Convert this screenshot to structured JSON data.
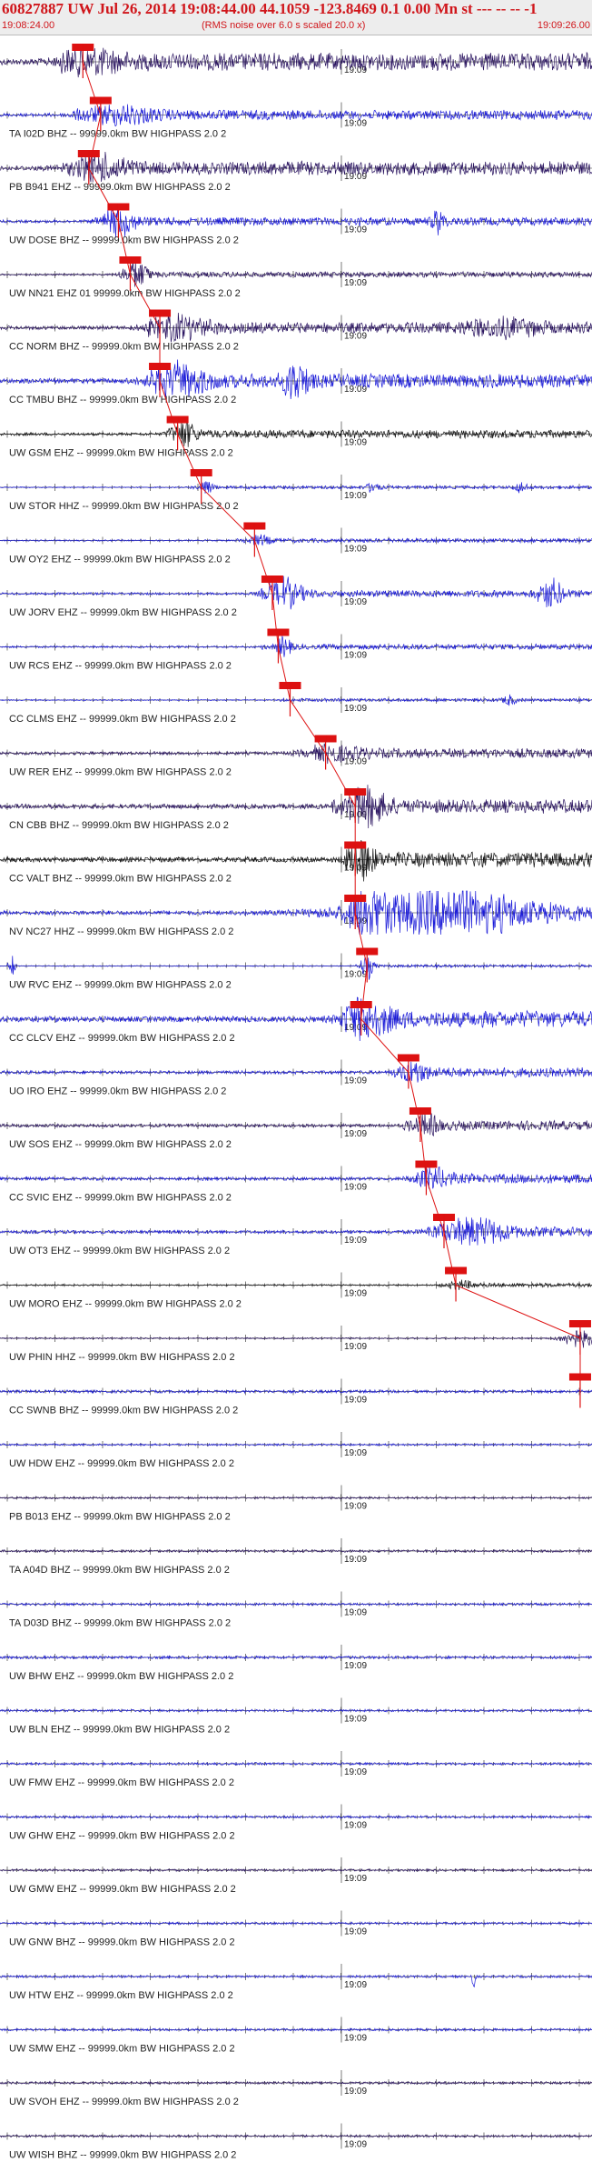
{
  "header": {
    "title": "60827887 UW Jul 26, 2014 19:08:44.00   44.1059 -123.8469  0.1 0.00 Mn st --- -- --  -1",
    "start_time": "19:08:24.00",
    "subtitle": "(RMS noise over 6.0 s scaled 20.0 x)",
    "end_time": "19:09:26.00"
  },
  "chart_data": {
    "type": "line",
    "title": "60827887 UW Jul 26, 2014 19:08:44.00   44.1059 -123.8469  0.1 0.00 Mn st --- -- --  -1",
    "subtitle": "(RMS noise over 6.0 s scaled 20.0 x)",
    "x_range": [
      "19:08:24.00",
      "19:09:26.00"
    ],
    "minute_label": "19:09",
    "colors": {
      "blue": "#1a1ad8",
      "dark": "#2a1460",
      "black": "#111111",
      "pick": "#dd1111",
      "axis": "#222222"
    },
    "traces": [
      {
        "label": "",
        "color": "dark",
        "amp": 0.65,
        "onset": 0.1,
        "pick": 0.14,
        "bursts": [
          [
            0.15,
            0.6,
            0.05
          ]
        ]
      },
      {
        "label": "TA I02D BHZ -- 99999.0km BW  HIGHPASS  2.0  2",
        "color": "blue",
        "amp": 0.35,
        "onset": 0.12,
        "pick": 0.17,
        "bursts": [
          [
            0.2,
            0.5,
            0.06
          ]
        ]
      },
      {
        "label": "PB B941 EHZ -- 99999.0km BW  HIGHPASS  2.0  2",
        "color": "dark",
        "amp": 0.5,
        "onset": 0.14,
        "pick": 0.15,
        "bursts": [
          [
            0.16,
            0.8,
            0.05
          ]
        ]
      },
      {
        "label": "UW DOSE BHZ -- 99999.0km BW  HIGHPASS  2.0  2",
        "color": "blue",
        "amp": 0.3,
        "onset": 0.18,
        "pick": 0.2,
        "bursts": [
          [
            0.2,
            0.9,
            0.03
          ],
          [
            0.74,
            0.8,
            0.01
          ]
        ]
      },
      {
        "label": "UW NN21 EHZ 01 99999.0km BW  HIGHPASS  2.0  2",
        "color": "dark",
        "amp": 0.2,
        "onset": 0.2,
        "pick": 0.22,
        "bursts": [
          [
            0.23,
            1.0,
            0.02
          ]
        ]
      },
      {
        "label": "CC NORM BHZ -- 99999.0km BW  HIGHPASS  2.0  2",
        "color": "dark",
        "amp": 0.4,
        "onset": 0.25,
        "pick": 0.27,
        "bursts": [
          [
            0.3,
            0.7,
            0.05
          ],
          [
            0.85,
            0.5,
            0.06
          ]
        ]
      },
      {
        "label": "CC TMBU BHZ -- 99999.0km BW  HIGHPASS  2.0  2",
        "color": "blue",
        "amp": 0.5,
        "onset": 0.25,
        "pick": 0.27,
        "bursts": [
          [
            0.3,
            1.0,
            0.05
          ],
          [
            0.5,
            1.3,
            0.02
          ]
        ]
      },
      {
        "label": "UW GSM EHZ -- 99999.0km BW  HIGHPASS  2.0  2",
        "color": "black",
        "amp": 0.3,
        "onset": 0.28,
        "pick": 0.3,
        "bursts": [
          [
            0.31,
            0.9,
            0.02
          ]
        ]
      },
      {
        "label": "UW STOR HHZ -- 99999.0km BW  HIGHPASS  2.0  2",
        "color": "blue",
        "amp": 0.12,
        "onset": 0.32,
        "pick": 0.34,
        "bursts": [
          [
            0.35,
            0.6,
            0.01
          ],
          [
            0.63,
            0.4,
            0.01
          ],
          [
            0.88,
            0.4,
            0.01
          ]
        ]
      },
      {
        "label": "UW OY2 EHZ -- 99999.0km BW  HIGHPASS  2.0  2",
        "color": "blue",
        "amp": 0.15,
        "onset": 0.4,
        "pick": 0.43,
        "bursts": [
          [
            0.44,
            0.3,
            0.02
          ]
        ]
      },
      {
        "label": "UW JORV EHZ -- 99999.0km BW  HIGHPASS  2.0  2",
        "color": "blue",
        "amp": 0.25,
        "onset": 0.44,
        "pick": 0.46,
        "bursts": [
          [
            0.48,
            1.0,
            0.03
          ],
          [
            0.93,
            1.0,
            0.02
          ]
        ]
      },
      {
        "label": "UW RCS EHZ -- 99999.0km BW  HIGHPASS  2.0  2",
        "color": "blue",
        "amp": 0.2,
        "onset": 0.44,
        "pick": 0.47,
        "bursts": [
          [
            0.48,
            0.8,
            0.01
          ]
        ]
      },
      {
        "label": "CC CLMS EHZ -- 99999.0km BW  HIGHPASS  2.0  2",
        "color": "blue",
        "amp": 0.12,
        "onset": 0.47,
        "pick": 0.49,
        "bursts": [
          [
            0.86,
            0.4,
            0.01
          ]
        ]
      },
      {
        "label": "UW RER EHZ -- 99999.0km BW  HIGHPASS  2.0  2",
        "color": "dark",
        "amp": 0.35,
        "onset": 0.53,
        "pick": 0.55,
        "bursts": [
          [
            0.56,
            0.4,
            0.05
          ]
        ]
      },
      {
        "label": "CN CBB BHZ -- 99999.0km BW  HIGHPASS  2.0  2",
        "color": "dark",
        "amp": 0.5,
        "onset": 0.56,
        "pick": 0.6,
        "bursts": [
          [
            0.62,
            1.4,
            0.03
          ]
        ]
      },
      {
        "label": "CC VALT BHZ -- 99999.0km BW  HIGHPASS  2.0  2",
        "color": "black",
        "amp": 0.55,
        "onset": 0.58,
        "pick": 0.6,
        "bursts": [
          [
            0.61,
            1.4,
            0.02
          ]
        ]
      },
      {
        "label": "NV NC27 HHZ -- 99999.0km BW  HIGHPASS  2.0  2",
        "color": "blue",
        "amp": 0.45,
        "onset": 0.58,
        "pick": 0.6,
        "bursts": [
          [
            0.62,
            1.5,
            0.02
          ],
          [
            0.75,
            1.5,
            0.15
          ]
        ]
      },
      {
        "label": "UW RVC EHZ -- 99999.0km BW  HIGHPASS  2.0  2",
        "color": "blue",
        "amp": 0.1,
        "onset": 0.6,
        "pick": 0.62,
        "bursts": [
          [
            0.02,
            1.0,
            0.005
          ],
          [
            0.62,
            1.0,
            0.01
          ]
        ]
      },
      {
        "label": "CC CLCV EHZ -- 99999.0km BW  HIGHPASS  2.0  2",
        "color": "blue",
        "amp": 0.6,
        "onset": 0.58,
        "pick": 0.61,
        "bursts": [
          [
            0.62,
            1.2,
            0.04
          ]
        ]
      },
      {
        "label": "UO IRO EHZ -- 99999.0km BW  HIGHPASS  2.0  2",
        "color": "blue",
        "amp": 0.35,
        "onset": 0.66,
        "pick": 0.69,
        "bursts": [
          [
            0.7,
            0.7,
            0.02
          ]
        ]
      },
      {
        "label": "UW SOS EHZ -- 99999.0km BW  HIGHPASS  2.0  2",
        "color": "dark",
        "amp": 0.35,
        "onset": 0.68,
        "pick": 0.71,
        "bursts": [
          [
            0.72,
            0.7,
            0.02
          ]
        ]
      },
      {
        "label": "CC SVIC EHZ -- 99999.0km BW  HIGHPASS  2.0  2",
        "color": "blue",
        "amp": 0.35,
        "onset": 0.7,
        "pick": 0.72,
        "bursts": [
          [
            0.73,
            0.6,
            0.03
          ]
        ]
      },
      {
        "label": "UW OT3 EHZ -- 99999.0km BW  HIGHPASS  2.0  2",
        "color": "blue",
        "amp": 0.35,
        "onset": 0.72,
        "pick": 0.75,
        "bursts": [
          [
            0.8,
            0.8,
            0.06
          ]
        ]
      },
      {
        "label": "UW MORO EHZ -- 99999.0km BW  HIGHPASS  2.0  2",
        "color": "black",
        "amp": 0.15,
        "onset": 0.74,
        "pick": 0.77,
        "bursts": [
          [
            0.78,
            0.3,
            0.02
          ]
        ]
      },
      {
        "label": "UW PHIN HHZ -- 99999.0km BW  HIGHPASS  2.0  2",
        "color": "dark",
        "amp": 0.15,
        "onset": 0.95,
        "pick": 0.98,
        "bursts": [
          [
            0.98,
            0.6,
            0.03
          ]
        ]
      },
      {
        "label": "CC SWNB BHZ -- 99999.0km BW  HIGHPASS  2.0  2",
        "color": "blue",
        "amp": 0.3,
        "onset": -1,
        "pick": 0.98,
        "bursts": []
      },
      {
        "label": "UW HDW EHZ -- 99999.0km BW  HIGHPASS  2.0  2",
        "color": "blue",
        "amp": 0.2,
        "onset": -1,
        "pick": -1,
        "bursts": []
      },
      {
        "label": "PB B013 EHZ -- 99999.0km BW  HIGHPASS  2.0  2",
        "color": "dark",
        "amp": 0.2,
        "onset": -1,
        "pick": -1,
        "bursts": []
      },
      {
        "label": "TA A04D BHZ -- 99999.0km BW  HIGHPASS  2.0  2",
        "color": "dark",
        "amp": 0.25,
        "onset": -1,
        "pick": -1,
        "bursts": []
      },
      {
        "label": "TA D03D BHZ -- 99999.0km BW  HIGHPASS  2.0  2",
        "color": "blue",
        "amp": 0.25,
        "onset": -1,
        "pick": -1,
        "bursts": []
      },
      {
        "label": "UW BHW EHZ -- 99999.0km BW  HIGHPASS  2.0  2",
        "color": "blue",
        "amp": 0.3,
        "onset": -1,
        "pick": -1,
        "bursts": []
      },
      {
        "label": "UW BLN EHZ -- 99999.0km BW  HIGHPASS  2.0  2",
        "color": "blue",
        "amp": 0.25,
        "onset": -1,
        "pick": -1,
        "bursts": []
      },
      {
        "label": "UW FMW EHZ -- 99999.0km BW  HIGHPASS  2.0  2",
        "color": "blue",
        "amp": 0.25,
        "onset": -1,
        "pick": -1,
        "bursts": []
      },
      {
        "label": "UW GHW EHZ -- 99999.0km BW  HIGHPASS  2.0  2",
        "color": "blue",
        "amp": 0.25,
        "onset": -1,
        "pick": -1,
        "bursts": []
      },
      {
        "label": "UW GMW EHZ -- 99999.0km BW  HIGHPASS  2.0  2",
        "color": "dark",
        "amp": 0.25,
        "onset": -1,
        "pick": -1,
        "bursts": []
      },
      {
        "label": "UW GNW BHZ -- 99999.0km BW  HIGHPASS  2.0  2",
        "color": "blue",
        "amp": 0.25,
        "onset": -1,
        "pick": -1,
        "bursts": []
      },
      {
        "label": "UW HTW EHZ -- 99999.0km BW  HIGHPASS  2.0  2",
        "color": "blue",
        "amp": 0.25,
        "onset": -1,
        "pick": -1,
        "bursts": [
          [
            0.8,
            1.0,
            0.003
          ]
        ]
      },
      {
        "label": "UW SMW EHZ -- 99999.0km BW  HIGHPASS  2.0  2",
        "color": "blue",
        "amp": 0.25,
        "onset": -1,
        "pick": -1,
        "bursts": []
      },
      {
        "label": "UW SVOH EHZ -- 99999.0km BW  HIGHPASS  2.0  2",
        "color": "dark",
        "amp": 0.25,
        "onset": -1,
        "pick": -1,
        "bursts": []
      },
      {
        "label": "UW WISH BHZ -- 99999.0km BW  HIGHPASS  2.0  2",
        "color": "dark",
        "amp": 0.25,
        "onset": -1,
        "pick": -1,
        "bursts": []
      }
    ]
  }
}
